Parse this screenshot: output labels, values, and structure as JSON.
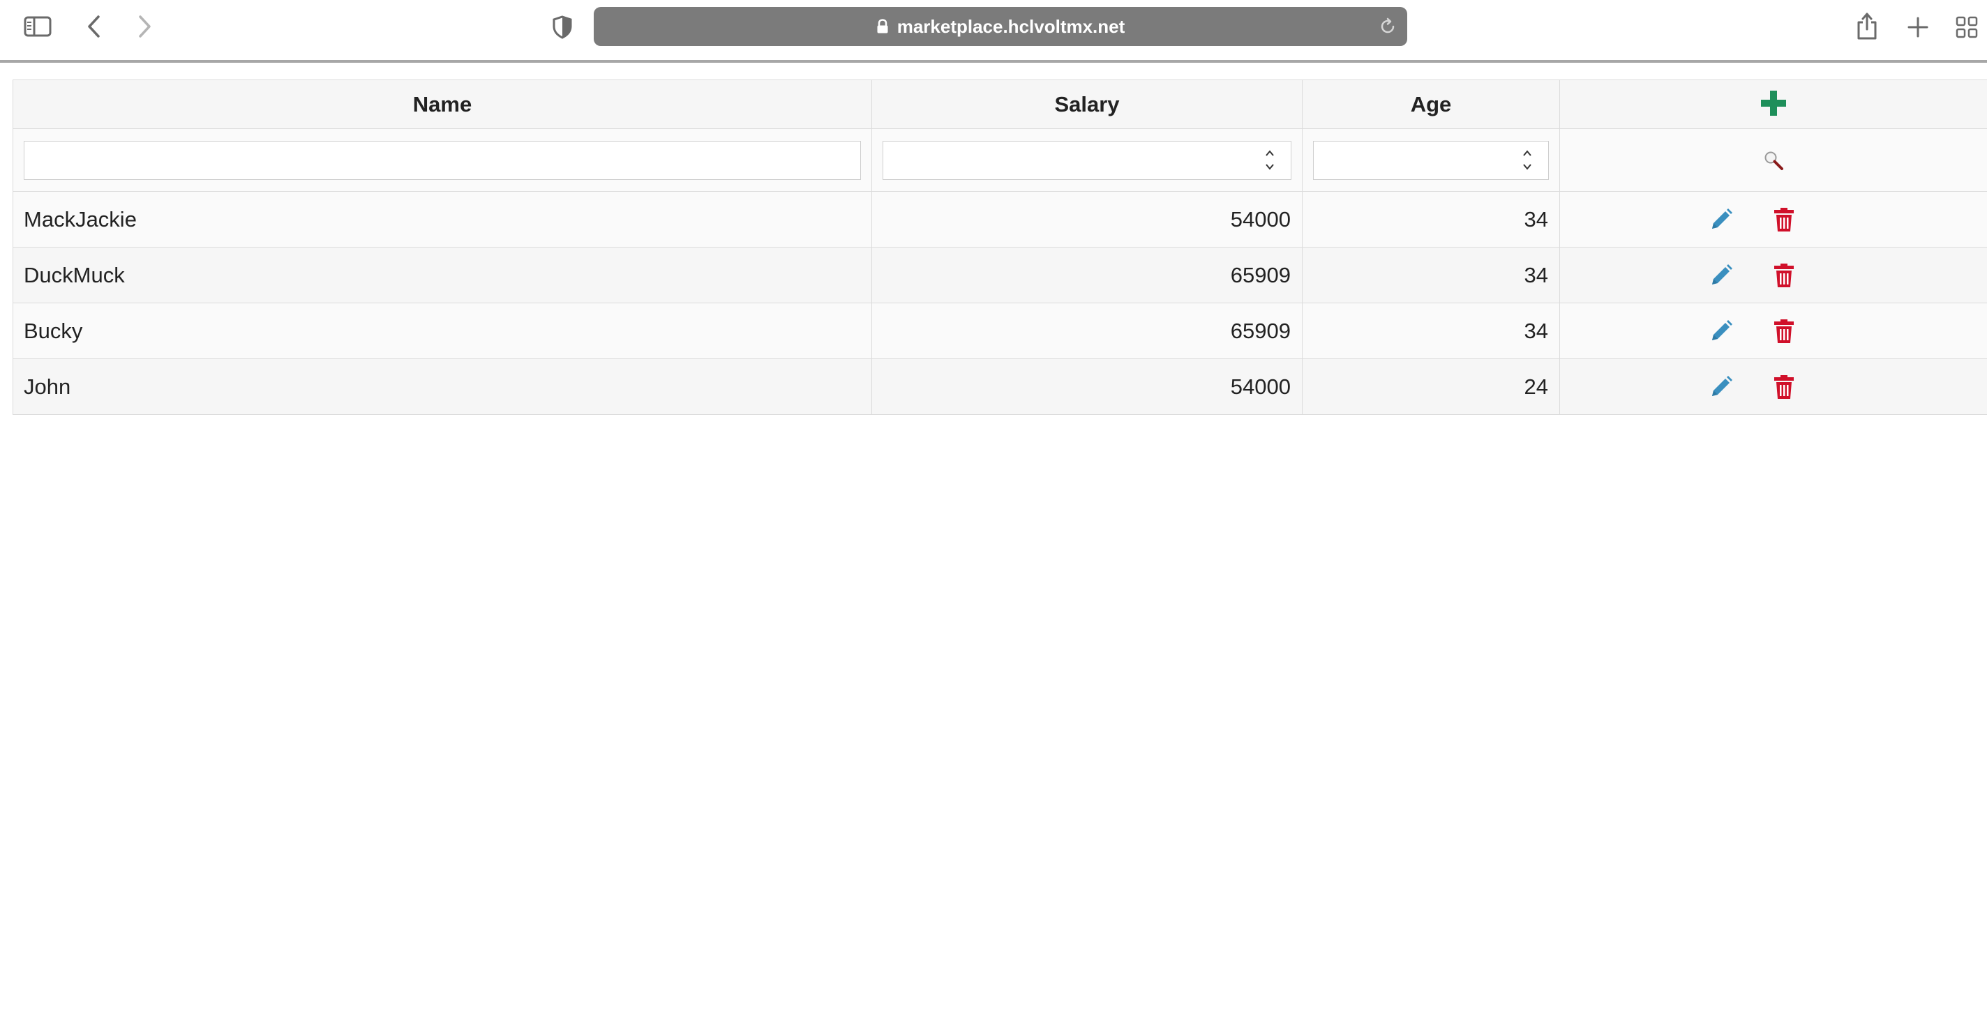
{
  "browser": {
    "url": "marketplace.hclvoltmx.net",
    "icons": {
      "sidebar": "sidebar-icon",
      "back": "chevron-left-icon",
      "forward": "chevron-right-icon",
      "privacy": "shield-icon",
      "lock": "lock-icon",
      "reload": "reload-icon",
      "share": "share-icon",
      "new_tab": "plus-icon",
      "tab_overview": "tab-grid-icon"
    }
  },
  "grid": {
    "columns": [
      {
        "key": "name",
        "label": "Name"
      },
      {
        "key": "salary",
        "label": "Salary"
      },
      {
        "key": "age",
        "label": "Age"
      }
    ],
    "filters": {
      "name": {
        "value": "",
        "placeholder": ""
      },
      "salary": {
        "value": "",
        "placeholder": ""
      },
      "age": {
        "value": "",
        "placeholder": ""
      }
    },
    "rows": [
      {
        "name": "MackJackie",
        "salary": "54000",
        "age": "34"
      },
      {
        "name": "DuckMuck",
        "salary": "65909",
        "age": "34"
      },
      {
        "name": "Bucky",
        "salary": "65909",
        "age": "34"
      },
      {
        "name": "John",
        "salary": "54000",
        "age": "24"
      }
    ],
    "colors": {
      "add": "#1e8f5a",
      "edit": "#3a8fbf",
      "delete": "#d0102a",
      "search_handle": "#8a1a1a"
    }
  }
}
